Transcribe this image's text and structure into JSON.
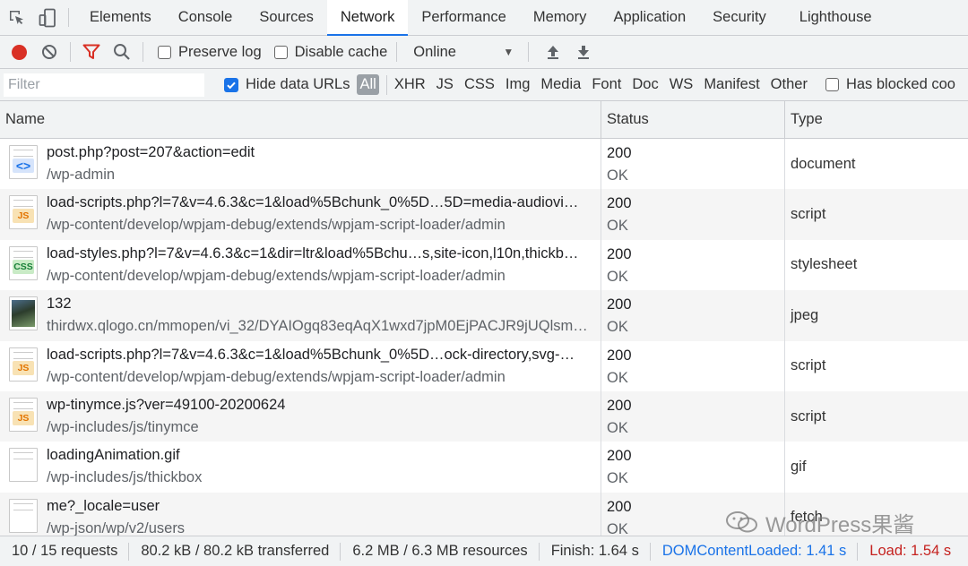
{
  "tabs": [
    {
      "label": "Elements"
    },
    {
      "label": "Console"
    },
    {
      "label": "Sources"
    },
    {
      "label": "Network",
      "active": true
    },
    {
      "label": "Performance"
    },
    {
      "label": "Memory"
    },
    {
      "label": "Application"
    },
    {
      "label": "Security"
    },
    {
      "label": "Lighthouse"
    }
  ],
  "toolbar": {
    "preserve_log_label": "Preserve log",
    "disable_cache_label": "Disable cache",
    "throttling_value": "Online",
    "record_color": "#d93025",
    "filter_icon_color": "#d93025"
  },
  "filterbar": {
    "filter_placeholder": "Filter",
    "hide_data_urls_label": "Hide data URLs",
    "types": [
      "All",
      "XHR",
      "JS",
      "CSS",
      "Img",
      "Media",
      "Font",
      "Doc",
      "WS",
      "Manifest",
      "Other"
    ],
    "has_blocked_label": "Has blocked coo"
  },
  "table": {
    "headers": {
      "name": "Name",
      "status": "Status",
      "type": "Type"
    },
    "rows": [
      {
        "icon": "html",
        "name": "post.php?post=207&action=edit",
        "path": "/wp-admin",
        "status": "200",
        "status_text": "OK",
        "type": "document"
      },
      {
        "icon": "js",
        "name": "load-scripts.php?l=7&v=4.6.3&c=1&load%5Bchunk_0%5D…5D=media-audiovi…",
        "path": "/wp-content/develop/wpjam-debug/extends/wpjam-script-loader/admin",
        "status": "200",
        "status_text": "OK",
        "type": "script"
      },
      {
        "icon": "css",
        "name": "load-styles.php?l=7&v=4.6.3&c=1&dir=ltr&load%5Bchu…s,site-icon,l10n,thickb…",
        "path": "/wp-content/develop/wpjam-debug/extends/wpjam-script-loader/admin",
        "status": "200",
        "status_text": "OK",
        "type": "stylesheet"
      },
      {
        "icon": "image",
        "name": "132",
        "path": "thirdwx.qlogo.cn/mmopen/vi_32/DYAIOgq83eqAqX1wxd7jpM0EjPACJR9jUQlsm…",
        "status": "200",
        "status_text": "OK",
        "type": "jpeg"
      },
      {
        "icon": "js",
        "name": "load-scripts.php?l=7&v=4.6.3&c=1&load%5Bchunk_0%5D…ock-directory,svg-…",
        "path": "/wp-content/develop/wpjam-debug/extends/wpjam-script-loader/admin",
        "status": "200",
        "status_text": "OK",
        "type": "script"
      },
      {
        "icon": "js",
        "name": "wp-tinymce.js?ver=49100-20200624",
        "path": "/wp-includes/js/tinymce",
        "status": "200",
        "status_text": "OK",
        "type": "script"
      },
      {
        "icon": "blank",
        "name": "loadingAnimation.gif",
        "path": "/wp-includes/js/thickbox",
        "status": "200",
        "status_text": "OK",
        "type": "gif"
      },
      {
        "icon": "blank",
        "name": "me?_locale=user",
        "path": "/wp-json/wp/v2/users",
        "status": "200",
        "status_text": "OK",
        "type": "fetch"
      }
    ]
  },
  "statusbar": {
    "requests": "10 / 15 requests",
    "transferred": "80.2 kB / 80.2 kB transferred",
    "resources": "6.2 MB / 6.3 MB resources",
    "finish": "Finish: 1.64 s",
    "dom_content_loaded": "DOMContentLoaded: 1.41 s",
    "load": "Load: 1.54 s"
  },
  "watermark": {
    "text": "WordPress果酱"
  }
}
